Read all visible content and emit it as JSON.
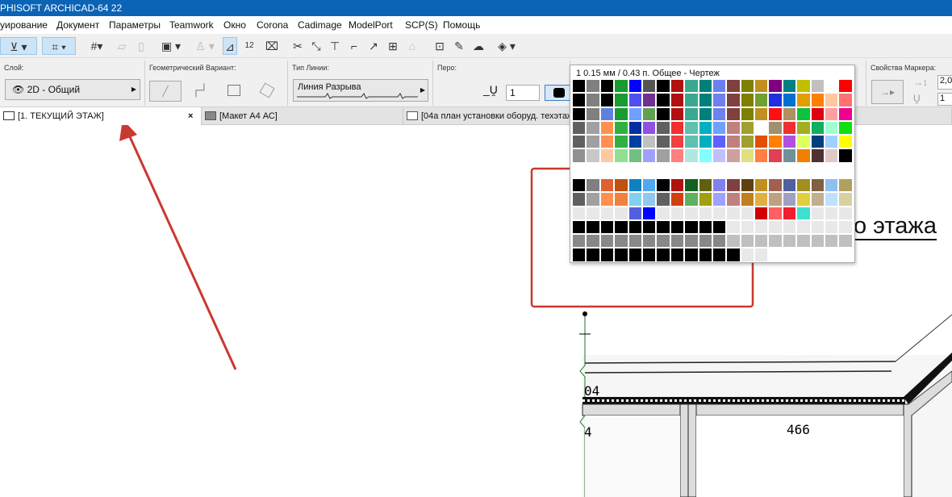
{
  "window": {
    "title": "PHISOFT ARCHICAD-64 22"
  },
  "menu": [
    "уирование",
    "Документ",
    "Параметры",
    "Teamwork",
    "Окно",
    "Corona",
    "Cadimage",
    "ModelPort",
    "SCP(S)",
    "Помощь"
  ],
  "info": {
    "layer_label": "Слой:",
    "layer_value": "2D - Общий",
    "geometry_label": "Геометрический Вариант:",
    "linetype_label": "Тип Линии:",
    "linetype_value": "Линия Разрыва",
    "pen_label": "Перо:",
    "pen_value": "1",
    "marker_label": "Свойства Маркера:",
    "marker_size": "2,0",
    "marker_pen": "1"
  },
  "tabs": [
    {
      "label": "[1. ТЕКУЩИЙ ЭТАЖ]",
      "active": true
    },
    {
      "label": "[Макет А4 АС]"
    },
    {
      "label": "[04а план установки оборуд. техэтаж"
    }
  ],
  "palette": {
    "title": "1  0.15 мм /  0.43 п. Общее - Чертеж",
    "selected_index": 0,
    "top_rows": [
      [
        "#000000",
        "#808080",
        "#000000",
        "#1a9a30",
        "#0000ff",
        "#555555",
        "#000000",
        "#b01010",
        "#3aa890",
        "#00807a",
        "#6a80f0",
        "#804040",
        "#808000",
        "#c09020",
        "#800080",
        "#008080",
        "#c0c000",
        "#c0c0c0",
        "#ffffff",
        "#ff0000"
      ],
      [
        "#000000",
        "#808080",
        "#000000",
        "#1a9a30",
        "#5050f0",
        "#703090",
        "#000000",
        "#b01010",
        "#3aa890",
        "#00807a",
        "#7080f0",
        "#804040",
        "#808000",
        "#70a030",
        "#2030e0",
        "#0070d0",
        "#e0a000",
        "#ff8000",
        "#ffc8a0",
        "#ff7070"
      ],
      [
        "#000000",
        "#808080",
        "#6080e0",
        "#1a9a30",
        "#70a0ff",
        "#60a050",
        "#000000",
        "#b01010",
        "#3aa890",
        "#00807a",
        "#7080f0",
        "#804040",
        "#808000",
        "#c09020",
        "#ff1010",
        "#b09060",
        "#10c040",
        "#e00010",
        "#ffa0a0",
        "#f00090"
      ],
      [
        "#606060",
        "#a0a0a0",
        "#ff9050",
        "#30b040",
        "#0030a0",
        "#9050e0",
        "#606060",
        "#f03030",
        "#60c0b0",
        "#00b0c0",
        "#70a0ff",
        "#c08080",
        "#a0a030",
        "#ffffff",
        "#a09070",
        "#f03030",
        "#a0b020",
        "#10b060",
        "#a0ffd0",
        "#10e010"
      ],
      [
        "#606060",
        "#a0a0a0",
        "#ff9050",
        "#30b040",
        "#0040a0",
        "#c0c0c0",
        "#606060",
        "#f04040",
        "#60c0b0",
        "#00b0c0",
        "#6060ff",
        "#c08080",
        "#a0a030",
        "#e05000",
        "#ff8000",
        "#b050e0",
        "#e0ff60",
        "#004080",
        "#a0d0ff",
        "#ffff00"
      ],
      [
        "#909090",
        "#c8c8c8",
        "#ffc8a0",
        "#90e090",
        "#70c080",
        "#a0a0ff",
        "#a0a0a0",
        "#ff8080",
        "#b0e8e0",
        "#80ffff",
        "#c0c0ff",
        "#d0a0a0",
        "#e0e080",
        "#ff8040",
        "#e04050",
        "#70909a",
        "#f08000",
        "#503030",
        "#e0c8c8",
        "#000000"
      ]
    ],
    "bottom_rows": [
      [
        "#000000",
        "#808080",
        "#e06030",
        "#c05010",
        "#1080c0",
        "#50a8f0",
        "#000008",
        "#b01010",
        "#106020",
        "#606010",
        "#8080f0",
        "#804040",
        "#604010",
        "#c09020",
        "#a06050",
        "#5060a0",
        "#a09020",
        "#806040",
        "#90c0f0",
        "#b0a060"
      ],
      [
        "#606060",
        "#a0a0a0",
        "#ff9050",
        "#f08040",
        "#80d0f0",
        "#90c8f0",
        "#606060",
        "#d04010",
        "#60b060",
        "#a0a010",
        "#a0a0ff",
        "#c08080",
        "#c08020",
        "#e0b040",
        "#c0a080",
        "#a0a0c0",
        "#e0d040",
        "#c0b090",
        "#c0e0ff",
        "#d8d0a0"
      ],
      [
        "#e8e8e8",
        "#e8e8e8",
        "#e8e8e8",
        "#e8e8e8",
        "#5060e0",
        "#0000ff",
        "#e8e8e8",
        "#e8e8e8",
        "#e8e8e8",
        "#e8e8e8",
        "#e8e8e8",
        "#e8e8e8",
        "#e8e8e8",
        "#d00000",
        "#ff6060",
        "#f02030",
        "#40e0d0",
        "#e8e8e8",
        "#e8e8e8",
        "#e8e8e8"
      ],
      [
        "#000000",
        "#000000",
        "#000000",
        "#000000",
        "#000000",
        "#000000",
        "#000000",
        "#000000",
        "#000000",
        "#000000",
        "#000000",
        "#e8e8e8",
        "#e8e8e8",
        "#e8e8e8",
        "#e8e8e8",
        "#e8e8e8",
        "#e8e8e8",
        "#e8e8e8",
        "#e8e8e8",
        "#e8e8e8"
      ],
      [
        "#888888",
        "#888888",
        "#888888",
        "#888888",
        "#888888",
        "#888888",
        "#888888",
        "#888888",
        "#888888",
        "#888888",
        "#888888",
        "#c0c0c0",
        "#c0c0c0",
        "#c0c0c0",
        "#c0c0c0",
        "#c0c0c0",
        "#c0c0c0",
        "#c0c0c0",
        "#c0c0c0",
        "#c0c0c0"
      ],
      [
        "#000000",
        "#000000",
        "#000000",
        "#000000",
        "#000000",
        "#000000",
        "#000000",
        "#000000",
        "#000000",
        "#000000",
        "#000000",
        "#000000",
        "#e8e8e8",
        "#e8e8e8",
        "#ffffff",
        "#ffffff",
        "#ffffff",
        "#ffffff",
        "#ffffff",
        "#ffffff"
      ]
    ]
  },
  "drawing": {
    "heading": "о этажа",
    "dim1": "04",
    "dim2": "4",
    "dim3": "466"
  },
  "annotation_color": "#c8392f"
}
